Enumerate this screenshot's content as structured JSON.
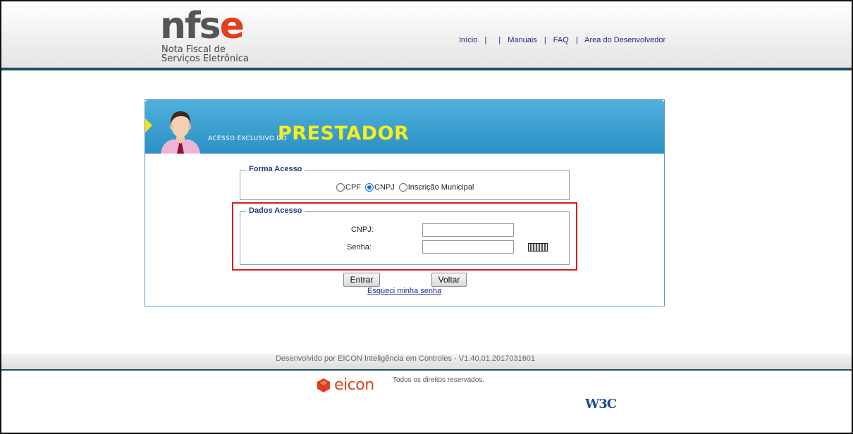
{
  "header": {
    "logo": {
      "word_gray": "nfs",
      "word_orange": "e",
      "tagline_line1": "Nota Fiscal de",
      "tagline_line2": "Serviços Eletrônica"
    },
    "nav": [
      {
        "label": "Início"
      },
      {
        "label": "Manuais"
      },
      {
        "label": "FAQ"
      },
      {
        "label": "Area do Desenvolvedor"
      }
    ],
    "nav_separator": "|"
  },
  "panel": {
    "banner_small": "Acesso exclusivo do",
    "banner_big": "PRESTADOR",
    "forma_acesso": {
      "legend": "Forma Acesso",
      "options": [
        {
          "label": "CPF",
          "checked": false
        },
        {
          "label": "CNPJ",
          "checked": true
        },
        {
          "label": "Inscrição Municipal",
          "checked": false
        }
      ]
    },
    "dados_acesso": {
      "legend": "Dados Acesso",
      "cnpj_label": "CNPJ:",
      "cnpj_value": "",
      "senha_label": "Senha:",
      "senha_value": "",
      "keyboard_icon": "virtual-keyboard-icon"
    },
    "buttons": {
      "entrar": "Entrar",
      "voltar": "Voltar"
    },
    "forgot_link": "Esqueci minha senha"
  },
  "footer": {
    "developed_by": "Desenvolvido por EICON Inteligência em Controles - V1.40.01.2017031601",
    "brand": "eicon",
    "rights": "Todos os direitos reservados.",
    "w3c": "W3C"
  },
  "colors": {
    "accent_orange": "#e2401c",
    "banner_blue": "#3fa3d4",
    "banner_yellow": "#f7ef1b",
    "highlight_red": "#d81b1b",
    "nav_blue": "#1f2a80"
  }
}
